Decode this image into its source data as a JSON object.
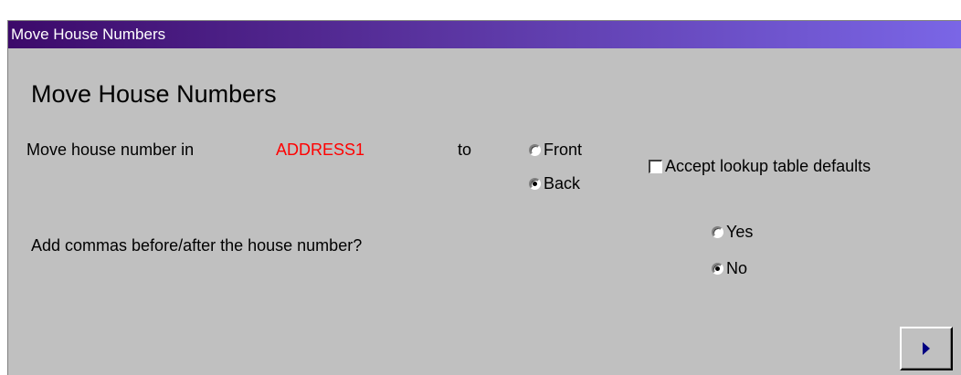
{
  "window": {
    "title": "Move House Numbers"
  },
  "dialog": {
    "heading": "Move House Numbers",
    "move_label": "Move house number in",
    "field_name": "ADDRESS1",
    "to_label": "to",
    "position_options": [
      {
        "label": "Front",
        "selected": false
      },
      {
        "label": "Back",
        "selected": true
      }
    ],
    "accept_defaults_label": "Accept lookup table defaults",
    "accept_defaults_checked": false,
    "commas_question": "Add commas before/after the house number?",
    "commas_options": [
      {
        "label": "Yes",
        "selected": false
      },
      {
        "label": "No",
        "selected": true
      }
    ],
    "next_icon": "play-arrow-icon"
  },
  "colors": {
    "title_gradient_start": "#3c0a6a",
    "title_gradient_end": "#7a66e6",
    "field_value": "#ff0000",
    "next_arrow": "#000080",
    "background": "#c0c0c0"
  }
}
